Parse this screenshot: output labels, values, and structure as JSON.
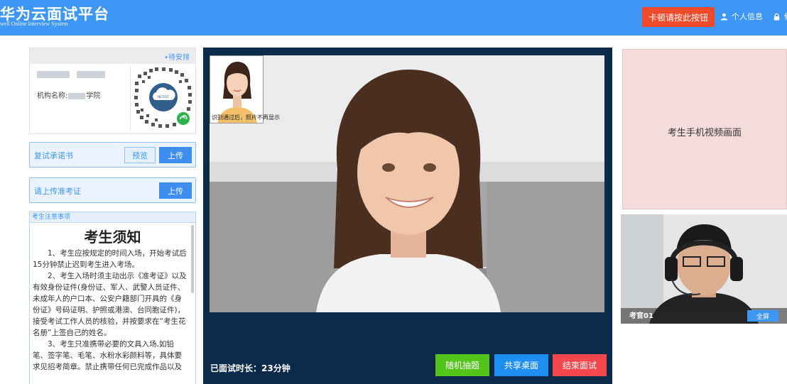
{
  "header": {
    "title": "华为云面试平台",
    "subtitle": "well Online Interview System",
    "stuck_button": "卡顿请按此按钮",
    "profile_link": "个人信息",
    "lock_link": "修",
    "bg_color": "#3e96f5",
    "alert_color": "#ef4a2c"
  },
  "info_card": {
    "pending_link": "•待安排",
    "org_label": "机构名称:",
    "org_suffix": "学院"
  },
  "commitment": {
    "label": "复试承诺书",
    "preview_button": "预览",
    "upload_button": "上传"
  },
  "admission": {
    "label": "请上传准考证",
    "upload_button": "上传"
  },
  "notice": {
    "header": "考生注意事项",
    "title": "考生须知",
    "paragraphs": [
      "1、考生应按规定的时间入场，开始考试后15分钟禁止迟到考生进入考场。",
      "2、考生入场时须主动出示《准考证》以及有效身份证件(身份证、军人、武警人员证件、未成年人的户口本、公安户籍部门开具的《身份证》号码证明、护照或港澳、台同胞证件)，接受考试工作人员的核验，并按要求在“考生花名册”上签自己的姓名。",
      "3、考生只准携带必要的文具入场,如铅笔、签字笔、毛笔、水粉水彩颜料等，具体要求见招考简章。禁止携带任何已完成作品以及"
    ]
  },
  "stage": {
    "id_photo_caption": "识别通过后，照片不再显示",
    "duration": "已面试时长：23分钟",
    "buttons": {
      "random": "随机抽题",
      "share": "共享桌面",
      "end": "结束面试"
    },
    "colors": {
      "background": "#0c2a4a",
      "random": "#52c41a",
      "share": "#1e8ff0",
      "end": "#f5484c"
    }
  },
  "right": {
    "phone_video_label": "考生手机视频画面",
    "examiner_name": "考官01",
    "fullscreen_button": "全屏"
  }
}
